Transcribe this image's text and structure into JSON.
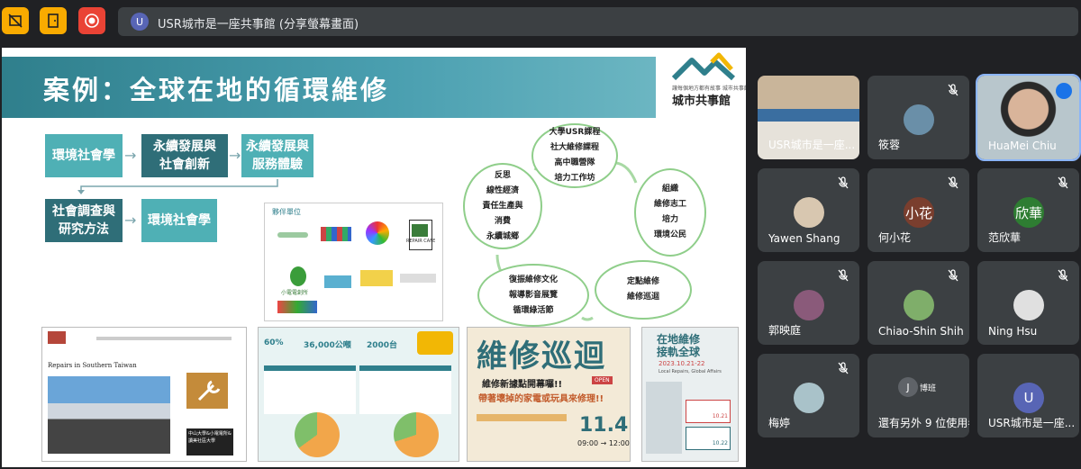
{
  "top_bar": {
    "buttons": [
      {
        "name": "no-camera-icon",
        "color": "#f9ab00"
      },
      {
        "name": "door-icon",
        "color": "#f9ab00"
      },
      {
        "name": "record-icon",
        "color": "#ea4335"
      }
    ],
    "presenter_initial": "U",
    "meeting_title": "USR城市是一座共事館 (分享螢幕畫面)"
  },
  "slide": {
    "title": "案例：全球在地的循環維修",
    "logo_text": "城市共事館",
    "logo_small": "讓每個地方都有故事 城市共事館",
    "flow": [
      "環境社會學",
      "永續發展與\n社會創新",
      "永續發展與\n服務體驗",
      "社會調查與\n研究方法",
      "環境社會學"
    ],
    "cycle": {
      "top": [
        "大學USR課程",
        "社大維修課程",
        "高中職營隊",
        "培力工作坊"
      ],
      "right": [
        "組織",
        "維修志工",
        "培力",
        "環境公民"
      ],
      "bottom_right": [
        "定點維修",
        "維修巡迴"
      ],
      "bottom_left": [
        "復振維修文化",
        "報導影音展覽",
        "循環綠活節"
      ],
      "left": [
        "反思",
        "線性經濟",
        "責任生產與",
        "消費",
        "永續城鄉"
      ]
    },
    "partners": {
      "header": "夥伴單位",
      "repair_cafe": "REPAIR CAFE",
      "gs": "小電電創所"
    },
    "thumb1": {
      "title": "Repairs in Southern Taiwan",
      "caption": "中山大學&小電電所&讀美社區大學"
    },
    "thumb2": {
      "stat1": "60%",
      "stat2": "36,000公噸",
      "stat3": "2000台"
    },
    "thumb3": {
      "title": "維修巡迴",
      "line1": "維修新據點開幕囉!!",
      "line2": "帶著壞掉的家電或玩具來修理!!",
      "open": "OPEN",
      "date": "11.4",
      "time": "09:00 → 12:00"
    },
    "thumb4": {
      "title": "在地維修\n接軌全球",
      "date": "2023.10.21-22",
      "sub": "Local Repairs, Global Affairs",
      "d1": "10.21",
      "d2": "10.22"
    }
  },
  "participants": [
    {
      "name": "USR城市是一座...",
      "type": "video",
      "muted": false
    },
    {
      "name": "筱蓉",
      "type": "avatar",
      "muted": true,
      "avatar_color": "#6a8fa8"
    },
    {
      "name": "HuaMei Chiu",
      "type": "video-self",
      "muted": false,
      "speaking": true
    },
    {
      "name": "Yawen Shang",
      "type": "avatar",
      "muted": true,
      "avatar_color": "#d8c7b0"
    },
    {
      "name": "何小花",
      "type": "initial",
      "initial": "小花",
      "muted": true,
      "avatar_color": "#7a3e2e"
    },
    {
      "name": "范欣華",
      "type": "initial",
      "initial": "欣華",
      "muted": true,
      "avatar_color": "#2e7d32"
    },
    {
      "name": "郭映庭",
      "type": "avatar",
      "muted": true,
      "avatar_color": "#8a5a7a"
    },
    {
      "name": "Chiao-Shin Shih",
      "type": "avatar",
      "muted": true,
      "avatar_color": "#7fae6a"
    },
    {
      "name": "Ning Hsu",
      "type": "avatar",
      "muted": true,
      "avatar_color": "#e0e0e0"
    },
    {
      "name": "梅婷",
      "type": "avatar",
      "muted": true,
      "avatar_color": "#a9c2c9"
    },
    {
      "name": "還有另外 9 位使用者",
      "type": "others",
      "muted": false,
      "initials": [
        "J",
        "博班"
      ]
    },
    {
      "name": "USR城市是一座...",
      "type": "initial",
      "initial": "U",
      "muted": false,
      "avatar_color": "#5865b5"
    }
  ]
}
